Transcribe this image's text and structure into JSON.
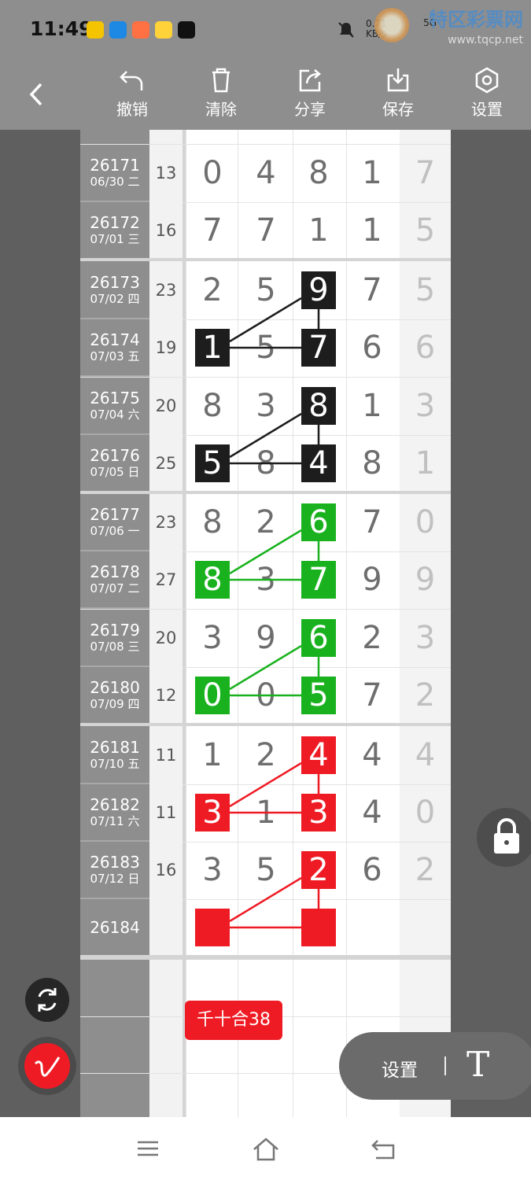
{
  "status_bar": {
    "time": "11:49",
    "network": "0.71 KB/s",
    "signal": "5G",
    "watermark_title": "特区彩票网",
    "watermark_url": "www.tqcp.net"
  },
  "toolbar": {
    "back_icon": "back-arrow-icon",
    "undo_label": "撤销",
    "clear_label": "清除",
    "share_label": "分享",
    "save_label": "保存",
    "settings_label": "设置"
  },
  "rows": [
    {
      "period": "26171",
      "date": "06/30 二",
      "sum": "13",
      "digits": [
        "0",
        "4",
        "8",
        "1"
      ],
      "last": "7"
    },
    {
      "period": "26172",
      "date": "07/01 三",
      "sum": "16",
      "digits": [
        "7",
        "7",
        "1",
        "1"
      ],
      "last": "5"
    },
    {
      "period": "26173",
      "date": "07/02 四",
      "sum": "23",
      "digits": [
        "2",
        "5",
        "9",
        "7"
      ],
      "last": "5"
    },
    {
      "period": "26174",
      "date": "07/03 五",
      "sum": "19",
      "digits": [
        "1",
        "5",
        "7",
        "6"
      ],
      "last": "6"
    },
    {
      "period": "26175",
      "date": "07/04 六",
      "sum": "20",
      "digits": [
        "8",
        "3",
        "8",
        "1"
      ],
      "last": "3"
    },
    {
      "period": "26176",
      "date": "07/05 日",
      "sum": "25",
      "digits": [
        "5",
        "8",
        "4",
        "8"
      ],
      "last": "1"
    },
    {
      "period": "26177",
      "date": "07/06 一",
      "sum": "23",
      "digits": [
        "8",
        "2",
        "6",
        "7"
      ],
      "last": "0"
    },
    {
      "period": "26178",
      "date": "07/07 二",
      "sum": "27",
      "digits": [
        "8",
        "3",
        "7",
        "9"
      ],
      "last": "9"
    },
    {
      "period": "26179",
      "date": "07/08 三",
      "sum": "20",
      "digits": [
        "3",
        "9",
        "6",
        "2"
      ],
      "last": "3"
    },
    {
      "period": "26180",
      "date": "07/09 四",
      "sum": "12",
      "digits": [
        "0",
        "0",
        "5",
        "7"
      ],
      "last": "2"
    },
    {
      "period": "26181",
      "date": "07/10 五",
      "sum": "11",
      "digits": [
        "1",
        "2",
        "4",
        "4"
      ],
      "last": "4"
    },
    {
      "period": "26182",
      "date": "07/11 六",
      "sum": "11",
      "digits": [
        "3",
        "1",
        "3",
        "4"
      ],
      "last": "0"
    },
    {
      "period": "26183",
      "date": "07/12 日",
      "sum": "16",
      "digits": [
        "3",
        "5",
        "2",
        "6"
      ],
      "last": "2"
    },
    {
      "period": "26184",
      "date": "",
      "sum": "",
      "digits": [
        "",
        "",
        "",
        ""
      ],
      "last": ""
    }
  ],
  "badge_text": "千十合38",
  "floating": {
    "settings_label": "设置",
    "text_tool": "T"
  },
  "colors": {
    "black": "#1d1d1d",
    "green": "#19b21e",
    "red": "#ef1b24"
  }
}
